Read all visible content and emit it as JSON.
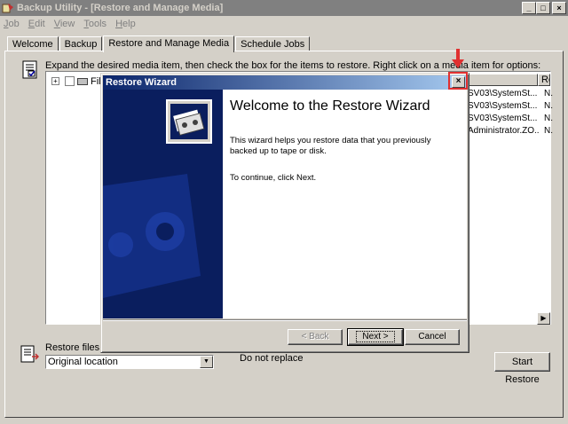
{
  "window": {
    "title": "Backup Utility - [Restore and Manage Media]",
    "buttons": {
      "minimize": "_",
      "maximize": "□",
      "close": "×"
    }
  },
  "menu": [
    {
      "label": "Job",
      "mnemonic": "J"
    },
    {
      "label": "Edit",
      "mnemonic": "E"
    },
    {
      "label": "View",
      "mnemonic": "V"
    },
    {
      "label": "Tools",
      "mnemonic": "T"
    },
    {
      "label": "Help",
      "mnemonic": "H"
    }
  ],
  "tabs": [
    "Welcome",
    "Backup",
    "Restore and Manage Media",
    "Schedule Jobs"
  ],
  "active_tab": "Restore and Manage Media",
  "panel": {
    "instruction": "Expand the desired media item, then check the box for the items to restore. Right click on a media item for options:",
    "tree_item_label": "File",
    "list_header": [
      "",
      "Re"
    ],
    "list_rows": [
      {
        "c1": "SV03\\SystemSt...",
        "c2": "N."
      },
      {
        "c1": "SV03\\SystemSt...",
        "c2": "N."
      },
      {
        "c1": "SV03\\SystemSt...",
        "c2": "N."
      },
      {
        "c1": "Administrator.ZO...",
        "c2": "N."
      }
    ],
    "restore_files_to_label": "Restore files to:",
    "restore_location": "Original location",
    "replace_option": "Do not replace",
    "start_restore": "Start Restore"
  },
  "dialog": {
    "title": "Restore Wizard",
    "heading": "Welcome to the Restore Wizard",
    "description": "This wizard helps you restore data that you previously backed up to tape or disk.",
    "continue_text": "To continue, click Next.",
    "buttons": {
      "back": "< Back",
      "next": "Next >",
      "cancel": "Cancel"
    }
  },
  "colors": {
    "face": "#d4d0c8",
    "dialog_title_start": "#0a246a",
    "dialog_side": "#0a1e5e",
    "annotation": "#e03030"
  }
}
